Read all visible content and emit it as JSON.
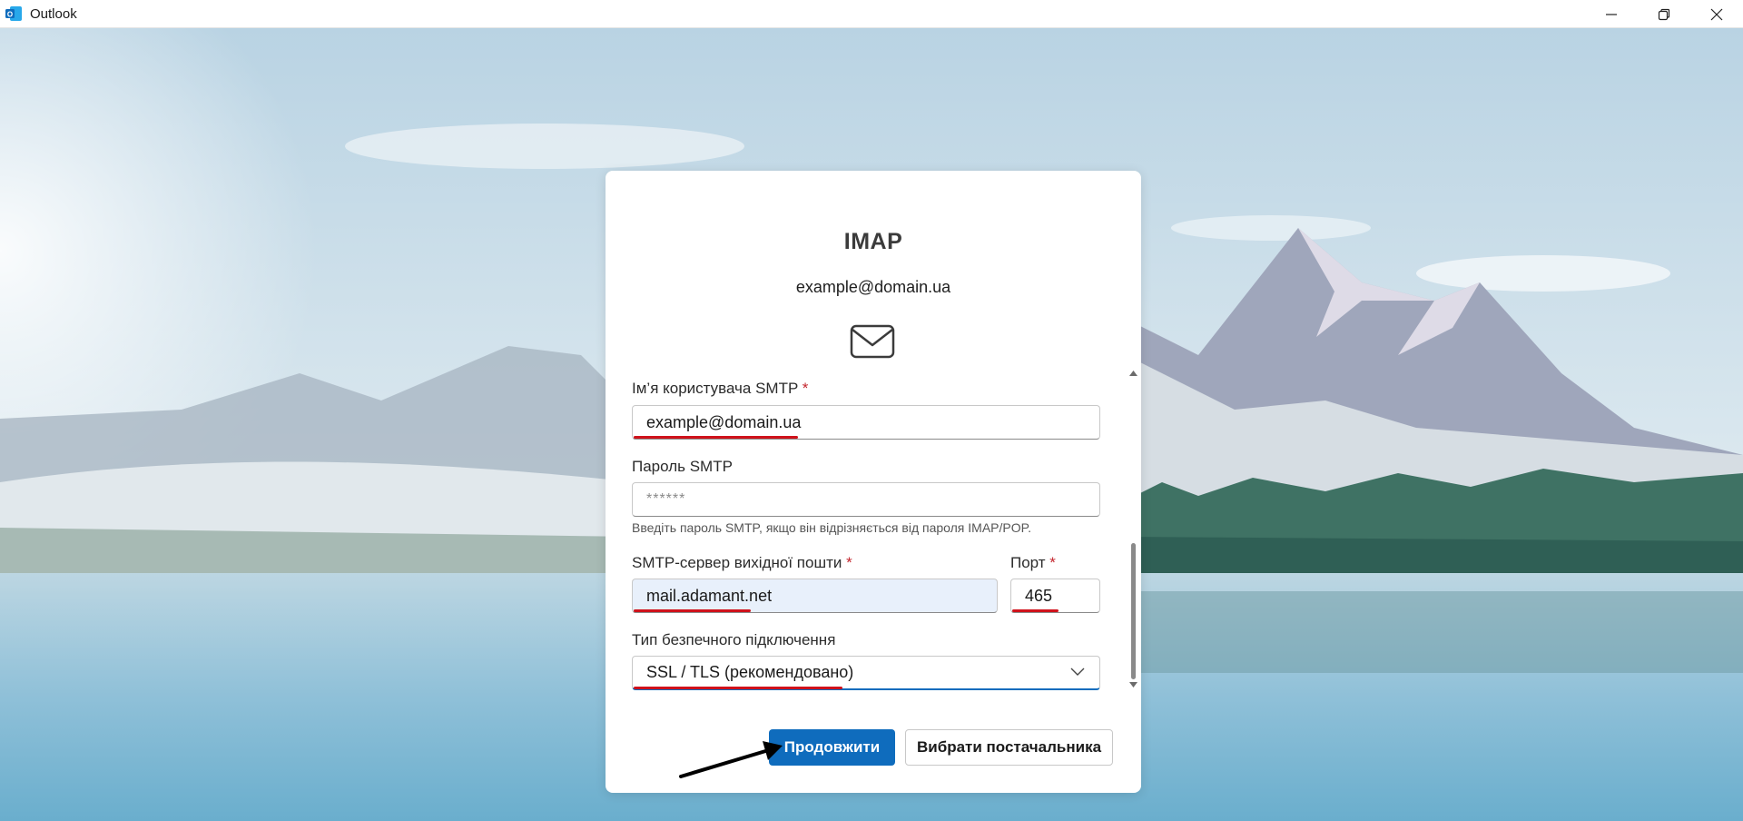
{
  "window": {
    "title": "Outlook"
  },
  "dialog": {
    "title": "IMAP",
    "account_email": "example@domain.ua",
    "smtp_username": {
      "label": "Ім’я користувача SMTP",
      "required_mark": "*",
      "value": "example@domain.ua"
    },
    "smtp_password": {
      "label": "Пароль SMTP",
      "value": "******",
      "hint": "Введіть пароль SMTP, якщо він відрізняється від пароля IMAP/POP."
    },
    "smtp_server": {
      "label": "SMTP-сервер вихідної пошти",
      "required_mark": "*",
      "value": "mail.adamant.net"
    },
    "port": {
      "label": "Порт",
      "required_mark": "*",
      "value": "465"
    },
    "security": {
      "label": "Тип безпечного підключення",
      "value": "SSL / TLS (рекомендовано)"
    },
    "continue_button": "Продовжити",
    "choose_provider_button": "Вибрати постачальника"
  },
  "colors": {
    "accent": "#0f6cbd",
    "required": "#c4262e",
    "annotation_underline": "#d0121b"
  }
}
